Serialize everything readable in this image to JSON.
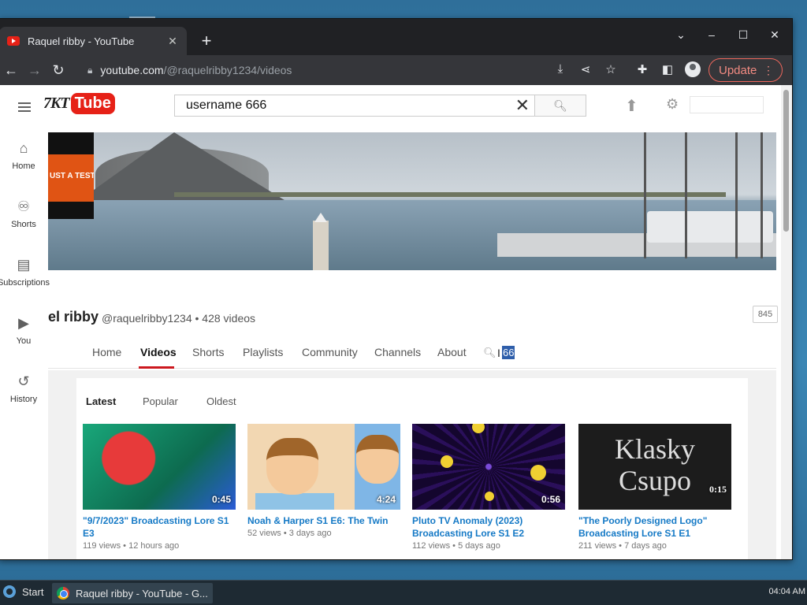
{
  "browser": {
    "tab_title": "Raquel ribby - YouTube",
    "url_host": "youtube.com",
    "url_path": "/@raquelribby1234/videos",
    "update_label": "Update"
  },
  "yt": {
    "logo_prefix": "7KT",
    "logo_tube": "Tube",
    "search_value": "username 666"
  },
  "sidebar": [
    {
      "label": "Home",
      "icon": "home-icon"
    },
    {
      "label": "Shorts",
      "icon": "shorts-icon"
    },
    {
      "label": "Subscriptions",
      "icon": "subscriptions-icon"
    },
    {
      "label": "You",
      "icon": "you-icon"
    },
    {
      "label": "History",
      "icon": "history-icon"
    }
  ],
  "banner": {
    "thumb_text": "UST A TEST"
  },
  "channel": {
    "name": "el ribby",
    "handle": "@raquelribby1234",
    "video_count": "• 428 videos",
    "subscriber_count": "845"
  },
  "channel_tabs": [
    "Home",
    "Videos",
    "Shorts",
    "Playlists",
    "Community",
    "Channels",
    "About"
  ],
  "channel_search_value": "66",
  "sort": [
    "Latest",
    "Popular",
    "Oldest"
  ],
  "videos": [
    {
      "title": "\"9/7/2023\" Broadcasting Lore S1 E3",
      "views": "119 views",
      "age": "12 hours ago",
      "duration": "0:45"
    },
    {
      "title": "Noah & Harper S1 E6: The Twin",
      "views": "52 views",
      "age": "3 days ago",
      "duration": "4:24"
    },
    {
      "title": "Pluto TV Anomaly (2023) Broadcasting Lore S1 E2",
      "views": "112 views",
      "age": "5 days ago",
      "duration": "0:56"
    },
    {
      "title": "\"The Poorly Designed Logo\" Broadcasting Lore S1 E1",
      "views": "211 views",
      "age": "7 days ago",
      "duration": "0:15",
      "thumb_text": "Klasky Csupo"
    }
  ],
  "taskbar": {
    "start_label": "Start",
    "task_label": "Raquel ribby - YouTube - G...",
    "clock": "04:04 AM"
  }
}
